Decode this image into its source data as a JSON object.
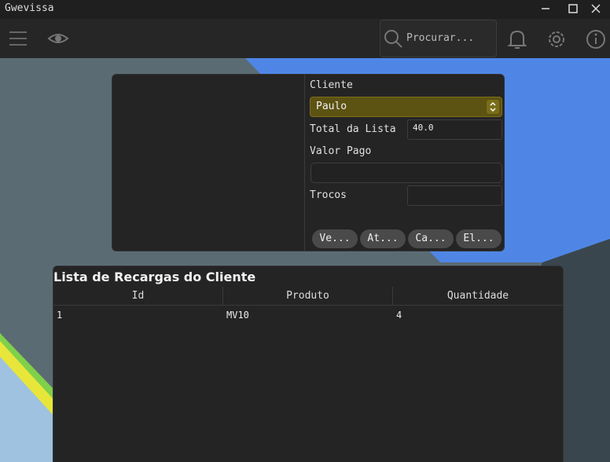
{
  "window": {
    "title": "Gwevissa"
  },
  "toolbar": {
    "search_placeholder": "Procurar..."
  },
  "form": {
    "cliente_label": "Cliente",
    "cliente_value": "Paulo",
    "total_label": "Total da Lista",
    "total_value": "40.0",
    "valor_pago_label": "Valor Pago",
    "valor_pago_value": "",
    "trocos_label": "Trocos",
    "trocos_value": "",
    "buttons": [
      "Ve...",
      "At...",
      "Ca...",
      "El..."
    ]
  },
  "table": {
    "title": "Lista de Recargas do Cliente",
    "columns": [
      "Id",
      "Produto",
      "Quantidade"
    ],
    "rows": [
      [
        "1",
        "MV10",
        "4"
      ]
    ]
  },
  "colors": {
    "accent_select": "#5c5212",
    "background_blue": "#4f86e6"
  }
}
